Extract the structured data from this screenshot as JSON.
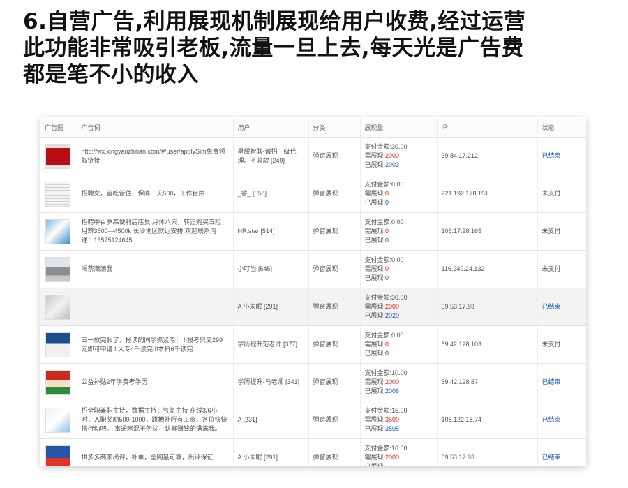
{
  "headline": {
    "line1": "6.自营广告,利用展现机制展现给用户收费,经过运营",
    "line2": "此功能非常吸引老板,流量一旦上去,每天光是广告费",
    "line3": "都是笔不小的收入"
  },
  "table": {
    "headers": {
      "image": "广告图",
      "words": "广告词",
      "user": "用户",
      "category": "分类",
      "impressions": "展现量",
      "ip": "IP",
      "status": "状态"
    },
    "labels": {
      "paid": "支付金额:",
      "required": "需展现:",
      "shown": "已展现:"
    },
    "rows": [
      {
        "thumb": "t-red",
        "words": "http://wx.xingyaozhilian.com/#/user/applySim免费领取链接",
        "user": "星耀智联-诚招一级代理。不收款 [249]",
        "category": "弹窗展现",
        "paid": "30.00",
        "required": "2000",
        "shown": "2003",
        "ip": "39.84.17.212",
        "status": "已结束",
        "status_done": true
      },
      {
        "thumb": "t-doc",
        "words": "招聘女，管吃管住，保底一天500，工作自由",
        "user": "_睿_ [558]",
        "category": "弹窗展现",
        "paid": "0.00",
        "required": "0",
        "shown": "0",
        "ip": "221.192.178.151",
        "status": "未支付",
        "status_done": false
      },
      {
        "thumb": "t-blue",
        "words": "招聘中百罗森便利店店员 月休八天，转正购买五险，月薪3500—4500k 长沙地区就近安排 欢迎联系沟通：13575124645",
        "user": "HR.star [514]",
        "category": "弹窗展现",
        "paid": "0.00",
        "required": "0",
        "shown": "0",
        "ip": "106.17.28.165",
        "status": "未支付",
        "status_done": false
      },
      {
        "thumb": "t-photo",
        "words": "喝茶潇潇我",
        "user": "小叮当 [545]",
        "category": "弹窗展现",
        "paid": "0.00",
        "required": "0",
        "shown": "0",
        "ip": "116.249.24.132",
        "status": "未支付",
        "status_done": false
      },
      {
        "thumb": "t-gray",
        "words": "",
        "user": "A 小未眠 [291]",
        "category": "弹窗展现",
        "paid": "30.00",
        "required": "2000",
        "shown": "2020",
        "ip": "59.53.17.93",
        "status": "已结束",
        "status_done": true,
        "highlight": true
      },
      {
        "thumb": "t-navy",
        "words": "五一放完假了，报读的同学抓紧哈！ !!报考只交299元即可申请 !!大专4千读完 !!本科6千读完",
        "user": "学历提升范老师 [377]",
        "category": "弹窗展现",
        "paid": "0.00",
        "required": "0",
        "shown": "0",
        "ip": "59.42.128.103",
        "status": "未支付",
        "status_done": false
      },
      {
        "thumb": "t-redb",
        "words": "公益补贴2年学费考学历",
        "user": "学历提升-马老师 [341]",
        "category": "弹窗展现",
        "paid": "10.00",
        "required": "2000",
        "shown": "2006",
        "ip": "59.42.128.87",
        "status": "已结束",
        "status_done": true
      },
      {
        "thumb": "t-light",
        "words": "招全职兼职主持，数据主持，气氛主持 在线3/6小时，入职奖励500-1000，跳槽补所有工资，各位快快快行动吧。 事通网混子勿扰，认真赚钱的满满我。",
        "user": "A [231]",
        "category": "弹窗展现",
        "paid": "15.00",
        "required": "3500",
        "shown": "3505",
        "ip": "106.122.18.74",
        "status": "已结束",
        "status_done": true
      },
      {
        "thumb": "t-mix",
        "words": "拼多多商家出评，补单，全网最可靠，出评保证",
        "user": "A 小未眠 [291]",
        "category": "弹窗展现",
        "paid": "10.00",
        "required": "2000",
        "shown": "",
        "ip": "59.53.17.93",
        "status": "已结束",
        "status_done": true
      }
    ]
  }
}
